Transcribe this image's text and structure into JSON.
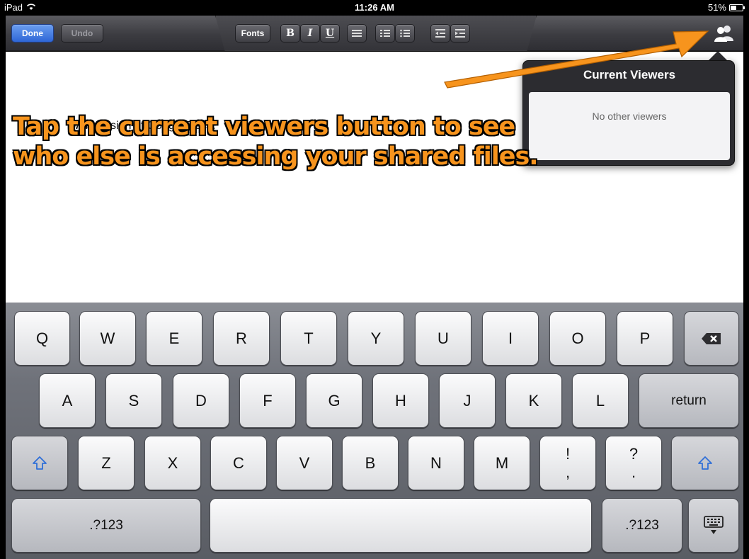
{
  "status_bar": {
    "device": "iPad",
    "time": "11:26 AM",
    "battery": "51%",
    "battery_level": 0.51
  },
  "toolbar": {
    "done_label": "Done",
    "undo_label": "Undo",
    "fonts_label": "Fonts",
    "bold_label": "B",
    "italic_label": "I",
    "underline_label": "U"
  },
  "document": {
    "text": "web version of Google Docs."
  },
  "popover": {
    "title": "Current Viewers",
    "empty_text": "No other viewers"
  },
  "annotation": {
    "line1": "Tap the current viewers button to see",
    "line2": "who else is accessing your shared files.",
    "color": "#f7941d"
  },
  "keyboard": {
    "row1": [
      "Q",
      "W",
      "E",
      "R",
      "T",
      "Y",
      "U",
      "I",
      "O",
      "P"
    ],
    "row2": [
      "A",
      "S",
      "D",
      "F",
      "G",
      "H",
      "J",
      "K",
      "L"
    ],
    "row3": [
      "Z",
      "X",
      "C",
      "V",
      "B",
      "N",
      "M"
    ],
    "exclaim_top": "!",
    "exclaim_bottom": ",",
    "question_top": "?",
    "question_bottom": ".",
    "return_label": "return",
    "numbers_left": ".?123",
    "numbers_right": ".?123"
  },
  "colors": {
    "done_accent": "#2e66d6",
    "toolbar": "#3c3c41"
  }
}
